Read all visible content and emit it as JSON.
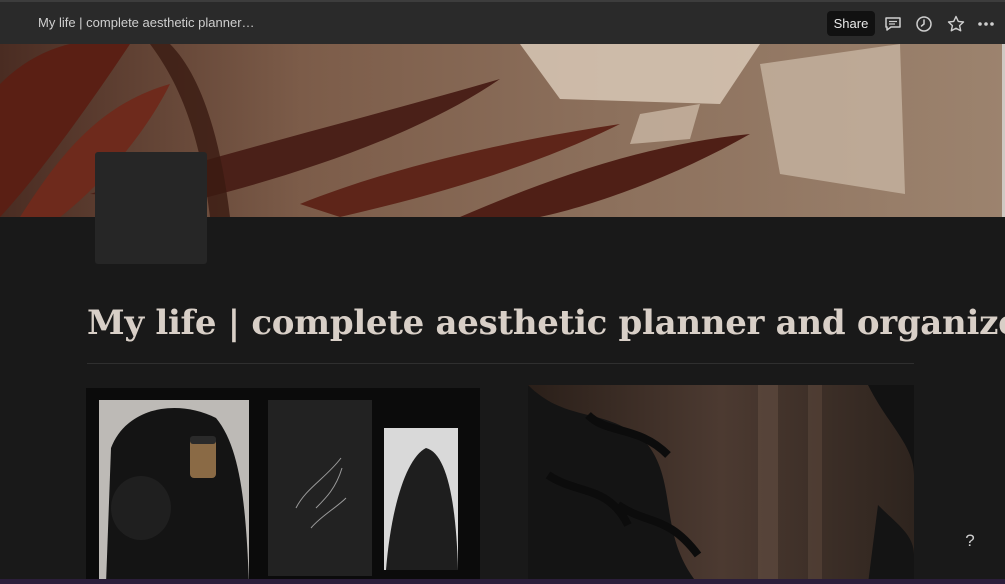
{
  "topbar": {
    "doc_title": "My life | complete aesthetic planner…",
    "share_label": "Share",
    "icons": [
      "comment-icon",
      "history-clock-icon",
      "star-favorite-icon",
      "more-dots-icon"
    ]
  },
  "page": {
    "title": "My life |  complete aesthetic planner and organizer"
  },
  "help": {
    "label": "?"
  },
  "colors": {
    "background": "#191919",
    "topbar": "#2a2a2a",
    "title_text": "#d8cfc7",
    "share_button": "#111111"
  }
}
